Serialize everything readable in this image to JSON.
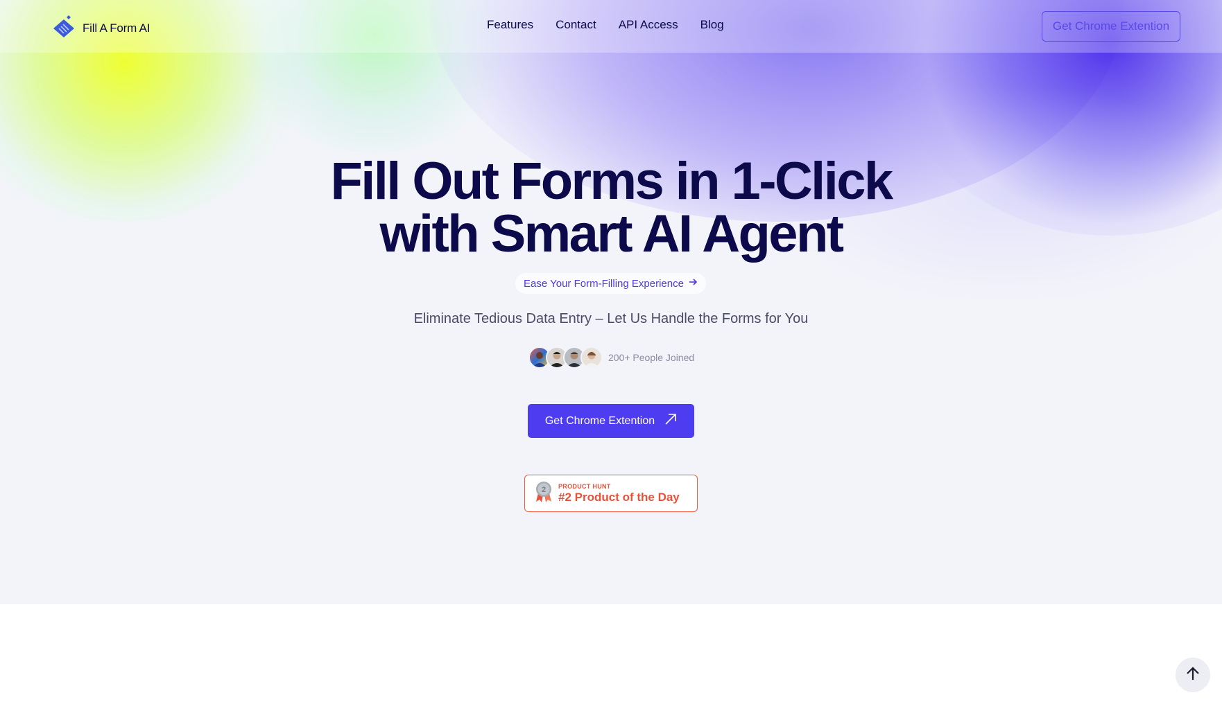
{
  "nav": {
    "brand": "Fill A Form AI",
    "links": [
      "Features",
      "Contact",
      "API Access",
      "Blog"
    ],
    "cta_label": "Get Chrome Extention"
  },
  "hero": {
    "headline_line1": "Fill Out Forms in 1-Click",
    "headline_line2": "with Smart AI Agent",
    "pill_label": "Ease Your Form-Filling Experience",
    "subheadline": "Eliminate Tedious Data Entry – Let Us Handle the Forms for You",
    "joined_text": "200+ People Joined",
    "cta_label": "Get Chrome Extention"
  },
  "product_hunt": {
    "label": "PRODUCT HUNT",
    "title": "#2 Product of the Day",
    "rank": "2"
  },
  "icons": {
    "logo": "diamond-logo-icon",
    "pill_arrow": "arrow-right-icon",
    "cta_arrow": "arrow-up-right-icon",
    "badge": "medal-icon",
    "scroll_top": "arrow-up-icon"
  },
  "colors": {
    "brand_primary": "#4e3cf0",
    "headline": "#0c0a4a",
    "product_hunt": "#e8513a"
  }
}
